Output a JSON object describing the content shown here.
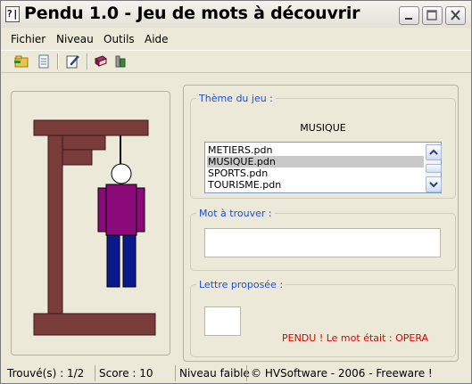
{
  "window": {
    "title": "Pendu 1.0 - Jeu de mots à découvrir",
    "app_icon_glyph": "?|",
    "controls": [
      "minimize",
      "maximize",
      "close"
    ]
  },
  "menu": [
    "Fichier",
    "Niveau",
    "Outils",
    "Aide"
  ],
  "toolbar": {
    "icons": [
      "open-folder-icon",
      "document-icon",
      "edit-icon",
      "book-icon",
      "tools-icon"
    ]
  },
  "theme": {
    "label": "Thème du jeu  :",
    "selected": "MUSIQUE",
    "items": [
      "METIERS.pdn",
      "MUSIQUE.pdn",
      "SPORTS.pdn",
      "TOURISME.pdn"
    ],
    "selected_index": 1
  },
  "word": {
    "label": "Mot à trouver :",
    "value": ""
  },
  "letter": {
    "label": "Lettre proposée :",
    "value": "",
    "message": "PENDU ! Le mot était : OPERA"
  },
  "status": {
    "found": "Trouvé(s) : 1/2",
    "score": "Score : 10",
    "level": "Niveau faible",
    "credits": "© HVSoftware - 2006 - Freeware !"
  },
  "colors": {
    "gallows": "#7a3b3b",
    "shirt": "#8a0a7a",
    "trousers": "#0a1a8c",
    "message": "#e00000",
    "group_label": "#1d4fd6"
  }
}
